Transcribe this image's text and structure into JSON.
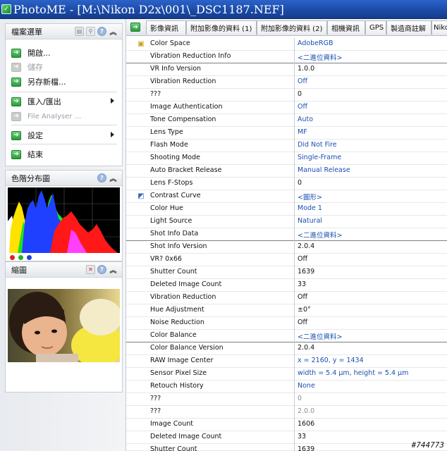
{
  "window": {
    "title": "PhotoME - [M:\\Nikon D2x\\001\\_DSC1187.NEF]"
  },
  "file_menu_panel": {
    "title": "檔案選單",
    "items": [
      {
        "label": "開啟...",
        "enabled": true
      },
      {
        "label": "儲存",
        "enabled": false
      },
      {
        "label": "另存新檔...",
        "enabled": true
      },
      {
        "label": "匯入/匯出",
        "enabled": true,
        "submenu": true
      },
      {
        "label": "File Analyser ...",
        "enabled": false
      },
      {
        "label": "設定",
        "enabled": true,
        "submenu": true
      },
      {
        "label": "結束",
        "enabled": true
      }
    ]
  },
  "histogram_panel": {
    "title": "色階分布圖",
    "channel_colors": [
      "#e02020",
      "#20b020",
      "#2040e0"
    ]
  },
  "thumbnail_panel": {
    "title": "縮圖"
  },
  "tabs": [
    "影像資訊",
    "附加影像的資料 (1)",
    "附加影像的資料 (2)",
    "相機資訊",
    "GPS",
    "製造商註解",
    "Nikon"
  ],
  "rows": [
    {
      "name": "Color Space",
      "value": "AdobeRGB",
      "icon": "rgb-cube-icon"
    },
    {
      "name": "Vibration Reduction Info",
      "value": "<二進位資料>",
      "section": true
    },
    {
      "name": "VR Info Version",
      "value": "1.0.0"
    },
    {
      "name": "Vibration Reduction",
      "value": "Off"
    },
    {
      "name": "???",
      "value": "0"
    },
    {
      "name": "Image Authentication",
      "value": "Off"
    },
    {
      "name": "Tone Compensation",
      "value": "Auto"
    },
    {
      "name": "Lens Type",
      "value": "MF"
    },
    {
      "name": "Flash Mode",
      "value": "Did Not Fire"
    },
    {
      "name": "Shooting Mode",
      "value": "Single-Frame"
    },
    {
      "name": "Auto Bracket Release",
      "value": "Manual Release"
    },
    {
      "name": "Lens F-Stops",
      "value": "0"
    },
    {
      "name": "Contrast Curve",
      "value": "<圖形>",
      "icon": "curve-graph-icon"
    },
    {
      "name": "Color Hue",
      "value": "Mode 1"
    },
    {
      "name": "Light Source",
      "value": "Natural"
    },
    {
      "name": "Shot Info Data",
      "value": "<二進位資料>",
      "section": true
    },
    {
      "name": "Shot Info Version",
      "value": "2.0.4"
    },
    {
      "name": "VR? 0x66",
      "value": "Off"
    },
    {
      "name": "Shutter Count",
      "value": "1639"
    },
    {
      "name": "Deleted Image Count",
      "value": "33"
    },
    {
      "name": "Vibration Reduction",
      "value": "Off"
    },
    {
      "name": "Hue Adjustment",
      "value": "±0°"
    },
    {
      "name": "Noise Reduction",
      "value": "Off"
    },
    {
      "name": "Color Balance",
      "value": "<二進位資料>",
      "section": true
    },
    {
      "name": "Color Balance Version",
      "value": "2.0.4"
    },
    {
      "name": "RAW Image Center",
      "value": "x = 2160, y = 1434"
    },
    {
      "name": "Sensor Pixel Size",
      "value": "width = 5.4 µm, height = 5.4 µm"
    },
    {
      "name": "Retouch History",
      "value": "None"
    },
    {
      "name": "???",
      "value": "0"
    },
    {
      "name": "???",
      "value": "2.0.0"
    },
    {
      "name": "Image Count",
      "value": "1606"
    },
    {
      "name": "Deleted Image Count",
      "value": "33"
    },
    {
      "name": "Shutter Count",
      "value": "1639"
    }
  ],
  "watermark": "#744773"
}
